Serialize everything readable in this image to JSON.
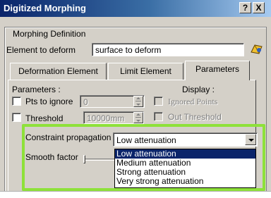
{
  "window": {
    "title": "Digitized Morphing",
    "help_label": "?",
    "close_label": "X"
  },
  "morphing_definition": {
    "legend": "Morphing Definition",
    "element_label": "Element to deform",
    "element_value": "surface to deform"
  },
  "tabs": [
    {
      "label": "Deformation Element"
    },
    {
      "label": "Limit Element"
    },
    {
      "label": "Parameters"
    }
  ],
  "parameters": {
    "heading": "Parameters :",
    "pts_to_ignore_label": "Pts to ignore",
    "pts_to_ignore_value": "0",
    "threshold_label": "Threshold",
    "threshold_value": "10000mm"
  },
  "display": {
    "heading": "Display :",
    "ignored_points_label": "Ignored Points",
    "out_threshold_label": "Out Threshold"
  },
  "constraint": {
    "label": "Constraint propagation",
    "selected": "Low attenuation",
    "options": [
      "Low attenuation",
      "Medium attenuation",
      "Strong attenuation",
      "Very strong attenuation"
    ]
  },
  "smooth_factor": {
    "label": "Smooth factor"
  },
  "colors": {
    "title_bar": "#0a246a",
    "highlight": "#8ee13a",
    "face": "#d4d0c8",
    "selection": "#0a246a"
  },
  "icons": {
    "element_picker": "surface-picker-icon"
  }
}
